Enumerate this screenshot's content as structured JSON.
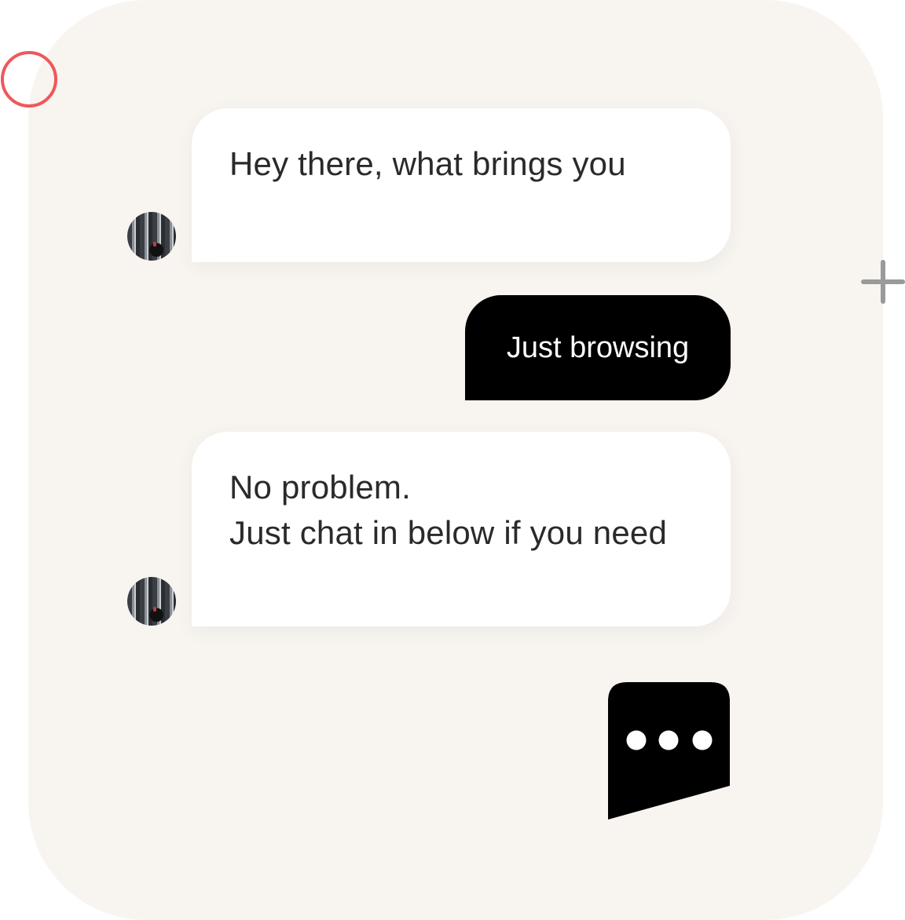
{
  "messages": [
    {
      "sender": "agent",
      "lines": [
        "Hey there, what brings you"
      ]
    },
    {
      "sender": "user",
      "text": "Just browsing"
    },
    {
      "sender": "agent",
      "lines": [
        "No problem.",
        "Just chat in below if you need"
      ]
    }
  ],
  "icons": {
    "avatar": "agent-avatar-photo",
    "launcher": "chat-bubble-dots-icon",
    "decor_circle": "circle-outline-icon",
    "decor_plus": "plus-icon"
  },
  "colors": {
    "card_background": "#f8f5f0",
    "agent_bubble": "#ffffff",
    "user_bubble": "#000000",
    "accent_circle": "#f0575a",
    "text_dark": "#2a2a2a"
  }
}
